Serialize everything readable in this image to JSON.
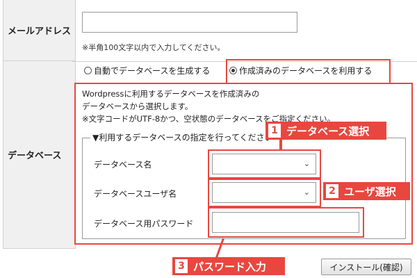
{
  "email": {
    "label": "メールアドレス",
    "value": "",
    "note": "※半角100文字以内で入力してください。"
  },
  "database": {
    "label": "データベース",
    "options": [
      {
        "label": "自動でデータベースを生成する",
        "selected": false
      },
      {
        "label": "作成済みのデータベースを利用する",
        "selected": true
      }
    ],
    "description": [
      "Wordpressに利用するデータベースを作成済みの",
      "データベースから選択します。",
      "※文字コードがUTF-8かつ、空状態のデータベースをご指定ください。"
    ],
    "legend": "▼利用するデータベースの指定を行ってください",
    "fields": {
      "db_name_label": "データベース名",
      "db_user_label": "データベースユーザ名",
      "db_password_label": "データベース用パスワード"
    }
  },
  "callouts": [
    {
      "num": "1",
      "text": "データベース選択"
    },
    {
      "num": "2",
      "text": "ユーザ選択"
    },
    {
      "num": "3",
      "text": "パスワード入力"
    }
  ],
  "install_button": "インストール(確認)",
  "colors": {
    "accent": "#e8473f",
    "label_bg": "#f0f0f0"
  },
  "icons": {
    "select_chevron": "chevron-down-icon"
  }
}
